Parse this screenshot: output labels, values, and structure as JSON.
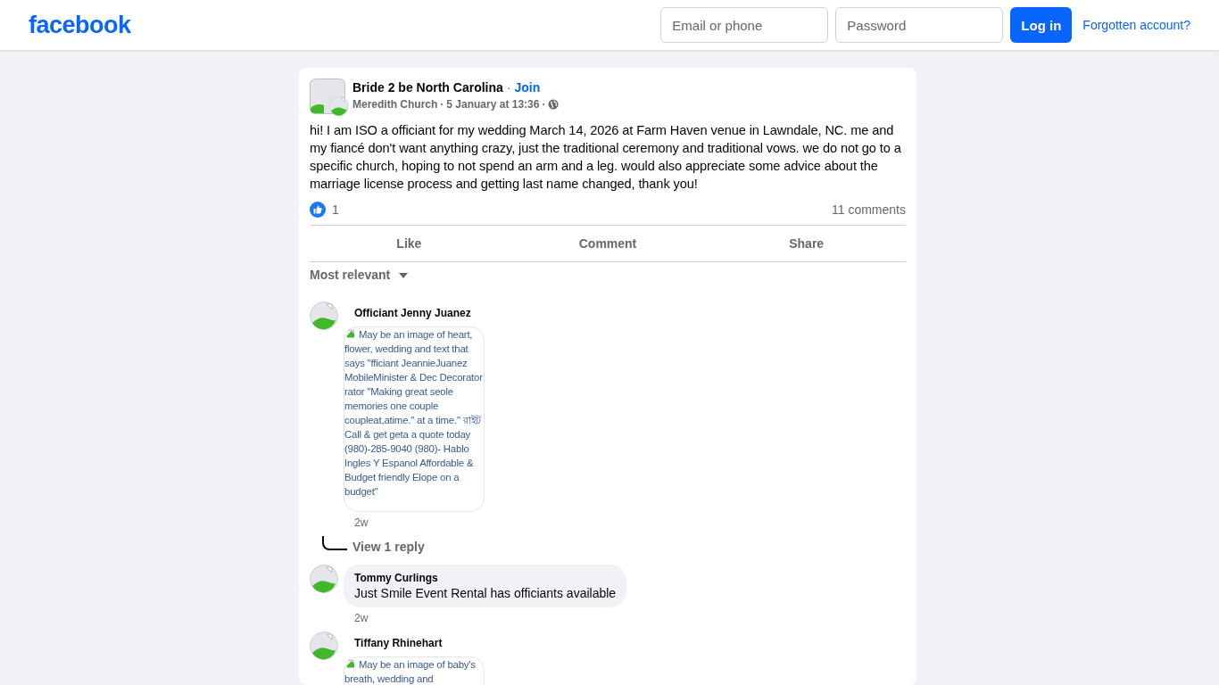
{
  "header": {
    "logo": "facebook",
    "email": {
      "placeholder": "Email or phone"
    },
    "password": {
      "placeholder": "Password"
    },
    "login": "Log in",
    "forgot": "Forgotten account?"
  },
  "post": {
    "group": "Bride 2 be North Carolina",
    "group_separator": "·",
    "join": "Join",
    "author": "Meredith Church",
    "author_separator": "·",
    "time": "5 January at 13:36",
    "time_separator": "·",
    "text": "hi! I am ISO a officiant for my wedding March 14, 2026 at Farm Haven venue in Lawndale, NC. me and my fiancé don't want anything crazy, just the traditional ceremony and traditional vows. we do not go to a specific church, hoping to not spend an arm and a leg. would also appreciate some advice about the marriage license process and getting last name changed, thank you!",
    "likes": "1",
    "comments_count": "11 comments",
    "actions": [
      "Like",
      "Comment",
      "Share"
    ],
    "sort": "Most relevant"
  },
  "comments": [
    {
      "kind": "image",
      "name": "Officiant Jenny Juanez",
      "alt": "May be an image of heart, flower, wedding and text that says \"fficiant JeannieJuanez MobileMinister & Dec Decorator rator \"Making great seole memories one couple coupleat,atime.\" at a time.\" রাইট Call & get geta a quote today (980)-285-9040 (980)- Hablo Ingles Y Espanol Affordable & Budget friendly Elope on a budget\"",
      "time": "2w",
      "replies": "View 1 reply"
    },
    {
      "kind": "text",
      "name": "Tommy Curlings",
      "text": "Just Smile Event Rental has officiants available",
      "time": "2w"
    },
    {
      "kind": "image",
      "name": "Tiffany Rhinehart",
      "alt": "May be an image of baby's breath, wedding and"
    }
  ]
}
